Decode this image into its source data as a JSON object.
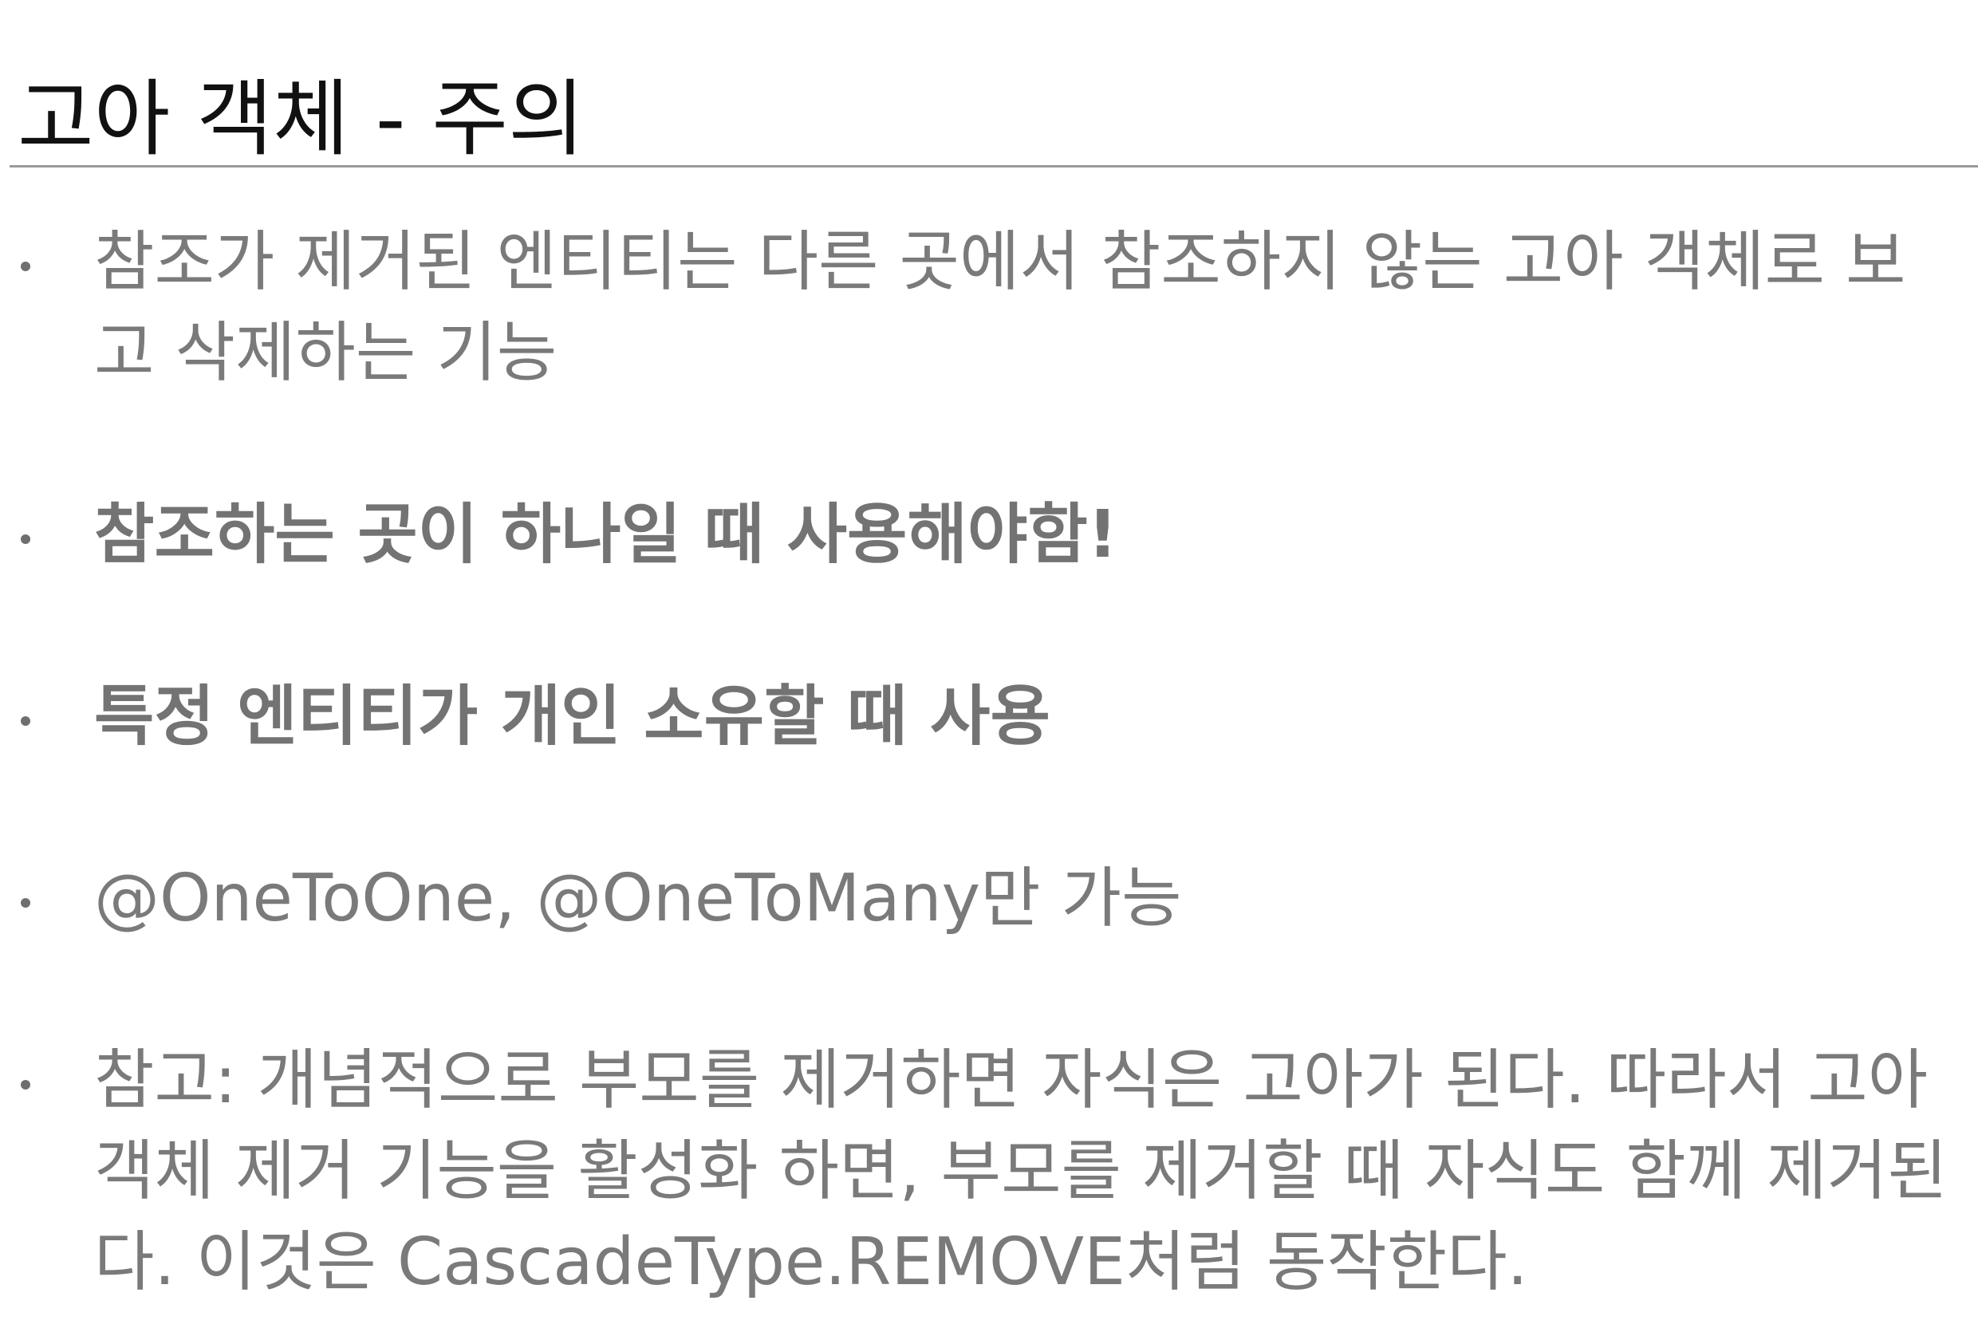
{
  "slide": {
    "title": "고아 객체 - 주의",
    "bullets": [
      {
        "text": "참조가 제거된 엔티티는 다른 곳에서 참조하지 않는 고아 객체로 보고 삭제하는 기능",
        "bold": false
      },
      {
        "text": "참조하는 곳이 하나일 때 사용해야함!",
        "bold": true
      },
      {
        "text": "특정 엔티티가 개인 소유할 때 사용",
        "bold": true
      },
      {
        "text": "@OneToOne, @OneToMany만 가능",
        "bold": false
      },
      {
        "text": "참고: 개념적으로 부모를 제거하면 자식은 고아가 된다. 따라서 고아 객체 제거 기능을 활성화 하면, 부모를 제거할 때 자식도 함께 제거된다. 이것은 CascadeType.REMOVE처럼 동작한다.",
        "bold": false
      }
    ]
  }
}
